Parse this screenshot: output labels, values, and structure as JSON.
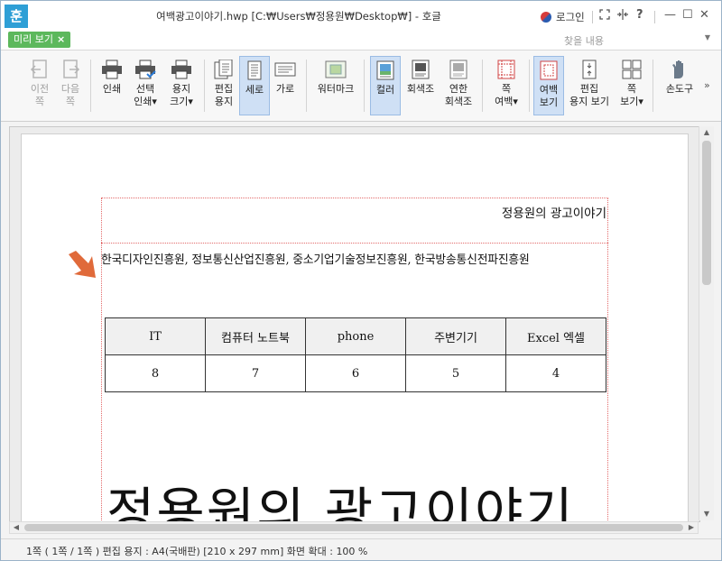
{
  "titlebar": {
    "app_logo": "훈",
    "title": "여백광고이야기.hwp [C:₩Users₩정용원₩Desktop₩] - 호글",
    "login": "로그인",
    "icons": [
      "fullscreen-icon",
      "fit-icon",
      "help-icon",
      "minimize-icon",
      "maximize-icon",
      "close-icon"
    ],
    "help_glyph": "?",
    "minimize_glyph": "—",
    "maximize_glyph": "☐",
    "close_glyph": "✕"
  },
  "tabbar": {
    "preview_tab": "미리 보기",
    "preview_close": "×",
    "find_placeholder": "찾을 내용"
  },
  "ribbon": {
    "buttons": [
      {
        "line1": "이전",
        "line2": "쪽",
        "icon": "prev-page-icon",
        "state": "disabled"
      },
      {
        "line1": "다음",
        "line2": "쪽",
        "icon": "next-page-icon",
        "state": "disabled"
      },
      {
        "line1": "인쇄",
        "line2": "",
        "icon": "print-icon",
        "state": "normal"
      },
      {
        "line1": "선택",
        "line2": "인쇄▾",
        "icon": "select-print-icon",
        "state": "normal"
      },
      {
        "line1": "용지",
        "line2": "크기▾",
        "icon": "paper-size-icon",
        "state": "normal"
      },
      {
        "line1": "편집",
        "line2": "용지",
        "icon": "edit-paper-icon",
        "state": "normal"
      },
      {
        "line1": "세로",
        "line2": "",
        "icon": "portrait-icon",
        "state": "active"
      },
      {
        "line1": "가로",
        "line2": "",
        "icon": "landscape-icon",
        "state": "normal"
      },
      {
        "line1": "워터마크",
        "line2": "",
        "icon": "watermark-icon",
        "state": "normal"
      },
      {
        "line1": "컬러",
        "line2": "",
        "icon": "color-icon",
        "state": "active"
      },
      {
        "line1": "회색조",
        "line2": "",
        "icon": "grayscale-icon",
        "state": "normal"
      },
      {
        "line1": "연한",
        "line2": "회색조",
        "icon": "light-grayscale-icon",
        "state": "normal"
      },
      {
        "line1": "쪽",
        "line2": "여백▾",
        "icon": "page-margin-icon",
        "state": "normal"
      },
      {
        "line1": "여백",
        "line2": "보기",
        "icon": "show-margin-icon",
        "state": "active"
      },
      {
        "line1": "편집",
        "line2": "용지 보기",
        "icon": "view-edit-paper-icon",
        "state": "normal"
      },
      {
        "line1": "쪽",
        "line2": "보기▾",
        "icon": "page-view-icon",
        "state": "normal"
      },
      {
        "line1": "손도구",
        "line2": "",
        "icon": "hand-tool-icon",
        "state": "normal"
      }
    ],
    "more": "»"
  },
  "document": {
    "header_text": "정용원의 광고이야기",
    "body_text": "한국디자인진흥원, 정보통신산업진흥원, 중소기업기술정보진흥원, 한국방송통신전파진흥원",
    "table": {
      "headers": [
        "IT",
        "컴퓨터 노트북",
        "phone",
        "주변기기",
        "Excel 엑셀"
      ],
      "values": [
        "8",
        "7",
        "6",
        "5",
        "4"
      ]
    },
    "big_title": "정용원의 광고이야기"
  },
  "scroll": {
    "up": "▲",
    "down": "▼",
    "left": "◀",
    "right": "▶"
  },
  "statusbar": {
    "text": "1쪽 ( 1쪽 / 1쪽 ) 편집 용지 : A4(국배판) [210 x 297 mm] 화면 확대 : 100 %"
  },
  "colors": {
    "accent": "#2e9fd6",
    "preview_tab": "#5cb85c",
    "arrow": "#e06a3a",
    "guide": "#e36a6a",
    "active_btn": "#cfe0f5"
  }
}
